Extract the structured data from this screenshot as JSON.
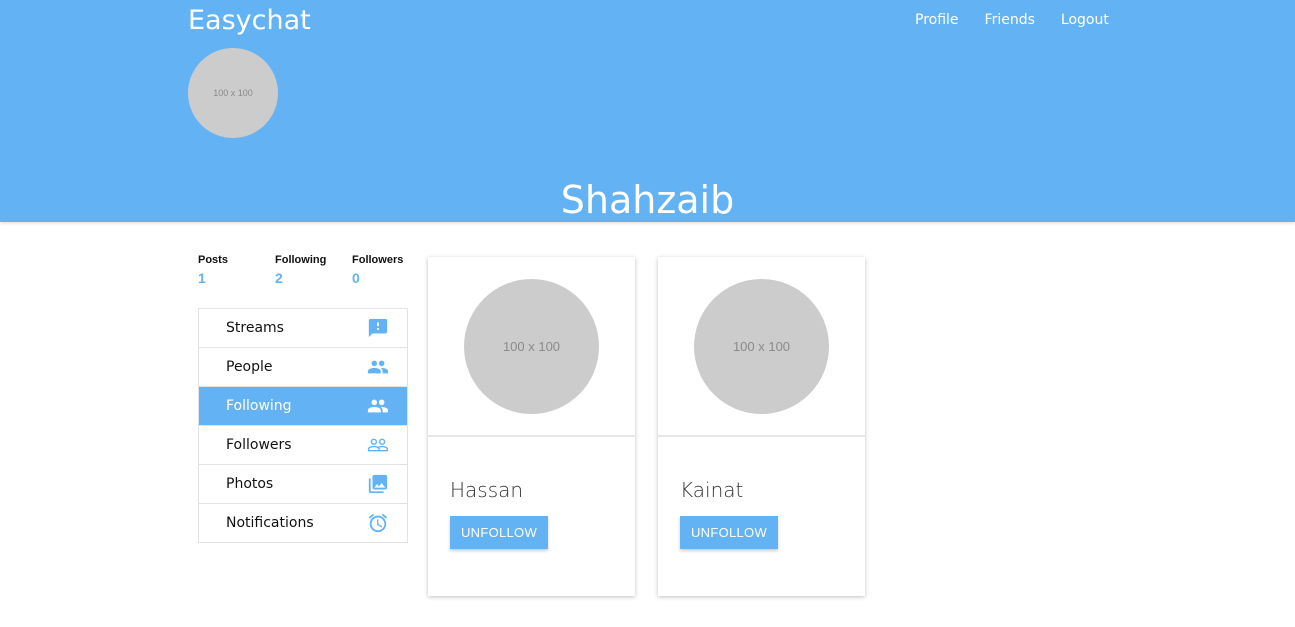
{
  "header": {
    "brand": "Easychat",
    "nav": [
      "Profile",
      "Friends",
      "Logout"
    ],
    "avatar_placeholder": "100 x 100",
    "username": "Shahzaib"
  },
  "stats": [
    {
      "label": "Posts",
      "value": "1"
    },
    {
      "label": "Following",
      "value": "2"
    },
    {
      "label": "Followers",
      "value": "0"
    }
  ],
  "menu": [
    {
      "label": "Streams",
      "icon": "feedback-icon"
    },
    {
      "label": "People",
      "icon": "people-icon"
    },
    {
      "label": "Following",
      "icon": "people-icon",
      "active": true
    },
    {
      "label": "Followers",
      "icon": "people-outline-icon"
    },
    {
      "label": "Photos",
      "icon": "photo-library-icon"
    },
    {
      "label": "Notifications",
      "icon": "alarm-icon"
    }
  ],
  "cards": [
    {
      "name": "Hassan",
      "avatar_placeholder": "100 x 100",
      "button": "UNFOLLOW"
    },
    {
      "name": "Kainat",
      "avatar_placeholder": "100 x 100",
      "button": "UNFOLLOW"
    }
  ],
  "colors": {
    "accent": "#63b3f4",
    "avatar_gray": "#cccccc"
  }
}
